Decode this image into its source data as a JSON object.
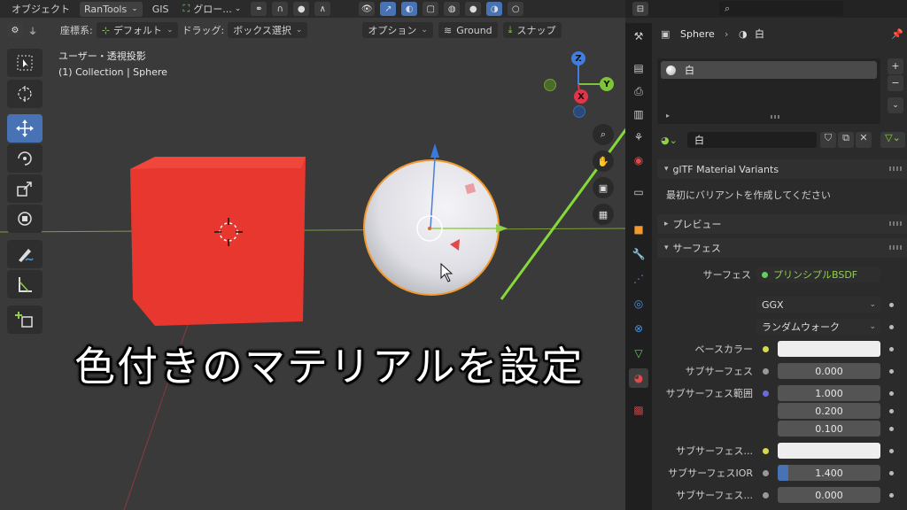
{
  "top_header": {
    "mode": "オブジェクト",
    "addon_menu": "RanTools",
    "gis_menu": "GIS",
    "orientation": "グロー...",
    "overlay_icons": [
      "pivot-icon",
      "snap-magnet-icon",
      "proportional-icon",
      "visibility-icon",
      "gizmo-icon",
      "xray-icon",
      "shading-wire-icon",
      "shading-solid-icon",
      "shading-material-icon",
      "shading-rendered-icon"
    ]
  },
  "tool_header": {
    "coord_label": "座標系:",
    "coord_value": "デフォルト",
    "drag_label": "ドラッグ:",
    "drag_value": "ボックス選択",
    "options": "オプション",
    "ground": "Ground",
    "snap": "スナップ"
  },
  "viewport": {
    "view_name": "ユーザー・透視投影",
    "collection": "(1) Collection | Sphere",
    "gizmo": {
      "z": "Z",
      "y": "Y",
      "x": "X"
    },
    "caption": "色付きのマテリアルを設定",
    "colors": {
      "cube": "#e8372f",
      "sphere": "#e9e9ee",
      "selection": "#f29a2e",
      "arrow": "#86d93a",
      "grid_x": "#9b3a3a",
      "grid_y": "#6f9a2a"
    }
  },
  "properties": {
    "search_placeholder": "",
    "breadcrumb_object": "Sphere",
    "breadcrumb_material": "白",
    "slot_name": "白",
    "material_name": "白",
    "gltf_panel": "glTF Material Variants",
    "gltf_hint": "最初にバリアントを作成してください",
    "preview_panel": "プレビュー",
    "surface_panel": "サーフェス",
    "surface_label": "サーフェス",
    "surface_value": "プリンシプルBSDF",
    "distribution": "GGX",
    "subsurface_method": "ランダムウォーク",
    "base_color_label": "ベースカラー",
    "subsurface_label": "サブサーフェス",
    "subsurface_value": "0.000",
    "subsurface_radius_label": "サブサーフェス範囲",
    "radius_values": [
      "1.000",
      "0.200",
      "0.100"
    ],
    "subsurface_color_label": "サブサーフェス...",
    "subsurface_ior_label": "サブサーフェスIOR",
    "subsurface_ior_value": "1.400",
    "subsurface_aniso_label": "サブサーフェス...",
    "subsurface_aniso_value": "0.000",
    "subsurface_ior_fill": 0.1
  }
}
